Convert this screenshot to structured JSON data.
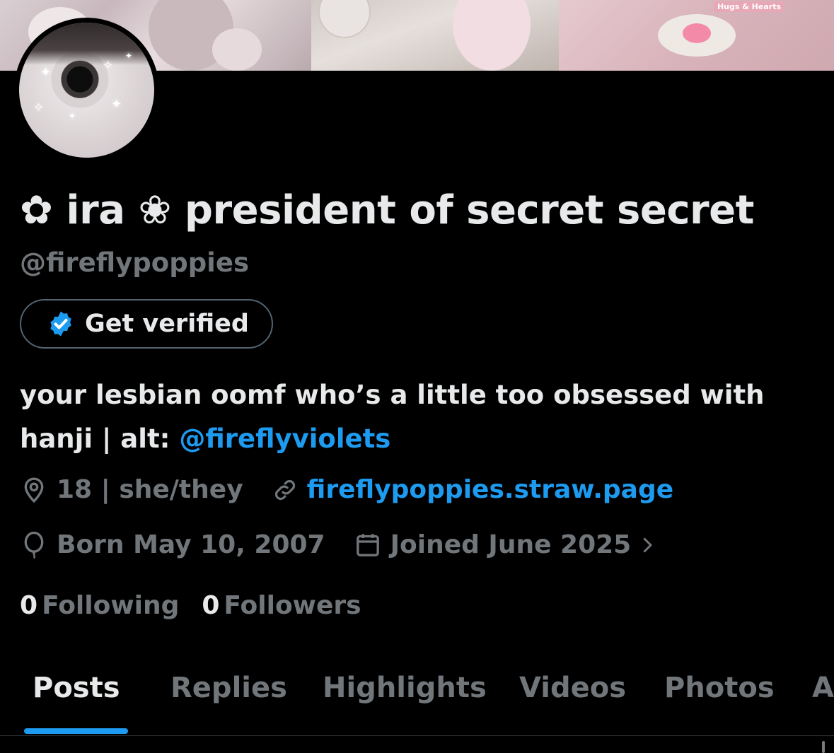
{
  "banner": {
    "badge_text": "Hugs & Hearts"
  },
  "profile": {
    "display_name": "✿ ira ❀ president of secret secret",
    "handle": "@fireflypoppies",
    "verify_button": "Get verified",
    "bio_text": "your lesbian oomf who’s a little too obsessed with hanji | alt: ",
    "bio_link": "@fireflyviolets",
    "location": "18 | she/they",
    "website": "fireflypoppies.straw.page",
    "birthday": "Born May 10, 2007",
    "joined": "Joined June 2025",
    "following_count": "0",
    "following_label": "Following",
    "followers_count": "0",
    "followers_label": "Followers"
  },
  "tabs": [
    {
      "label": "Posts",
      "active": true
    },
    {
      "label": "Replies",
      "active": false
    },
    {
      "label": "Highlights",
      "active": false
    },
    {
      "label": "Videos",
      "active": false
    },
    {
      "label": "Photos",
      "active": false
    },
    {
      "label": "A",
      "active": false
    }
  ],
  "colors": {
    "background": "#000000",
    "text_primary": "#e7e9ea",
    "text_secondary": "#71767b",
    "accent": "#1d9bf0",
    "button_border": "#536471"
  },
  "icons": {
    "location": "location-pin-icon",
    "website": "link-icon",
    "birthday": "balloon-icon",
    "joined": "calendar-icon",
    "verified": "verified-badge-icon",
    "chevron": "chevron-right-icon"
  }
}
